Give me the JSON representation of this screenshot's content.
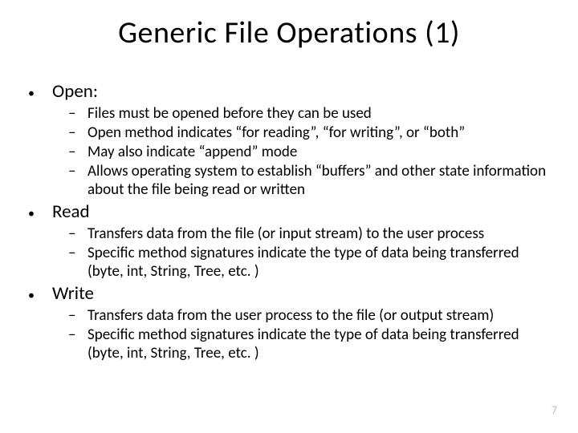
{
  "title": "Generic File Operations (1)",
  "page_number": "7",
  "bullets": [
    {
      "label": "Open:",
      "sub": [
        "Files must be opened before they can be used",
        "Open method indicates “for reading”, “for writing”, or “both”",
        "May also indicate “append” mode",
        "Allows operating system to establish “buffers” and other state information about the file being read or written"
      ]
    },
    {
      "label": "Read",
      "sub": [
        "Transfers data from the file (or input stream) to the user process",
        "Specific method signatures indicate the type of data being transferred (byte, int, String, Tree, etc. )"
      ]
    },
    {
      "label": "Write",
      "sub": [
        "Transfers data from the user process to the file (or output stream)",
        "Specific method signatures indicate the type of data being transferred (byte, int, String, Tree, etc. )"
      ]
    }
  ]
}
